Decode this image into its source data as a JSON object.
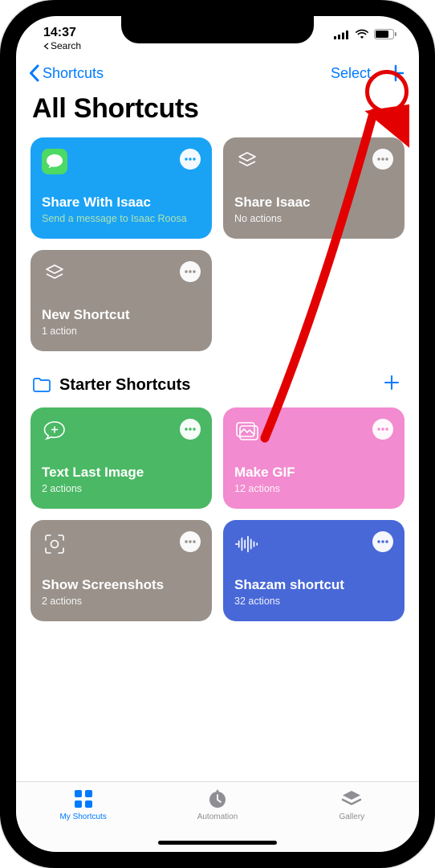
{
  "status": {
    "time": "14:37",
    "back_label": "Search"
  },
  "nav": {
    "back": "Shortcuts",
    "select": "Select"
  },
  "title": "All Shortcuts",
  "shortcuts": [
    {
      "title": "Share With Isaac",
      "sub": "Send a message to Isaac Roosa",
      "color": "#1aa3f5",
      "icon": "messages"
    },
    {
      "title": "Share Isaac",
      "sub": "No actions",
      "color": "#99918a",
      "icon": "layers"
    },
    {
      "title": "New Shortcut",
      "sub": "1 action",
      "color": "#99918a",
      "icon": "layers"
    }
  ],
  "section": {
    "title": "Starter Shortcuts"
  },
  "starters": [
    {
      "title": "Text Last Image",
      "sub": "2 actions",
      "color": "#4ab864",
      "icon": "chat-plus"
    },
    {
      "title": "Make GIF",
      "sub": "12 actions",
      "color": "#f28bcf",
      "icon": "photos"
    },
    {
      "title": "Show Screenshots",
      "sub": "2 actions",
      "color": "#99918a",
      "icon": "screenshot"
    },
    {
      "title": "Shazam shortcut",
      "sub": "32 actions",
      "color": "#4868d8",
      "icon": "waveform"
    }
  ],
  "tabs": {
    "my": "My Shortcuts",
    "auto": "Automation",
    "gallery": "Gallery"
  }
}
